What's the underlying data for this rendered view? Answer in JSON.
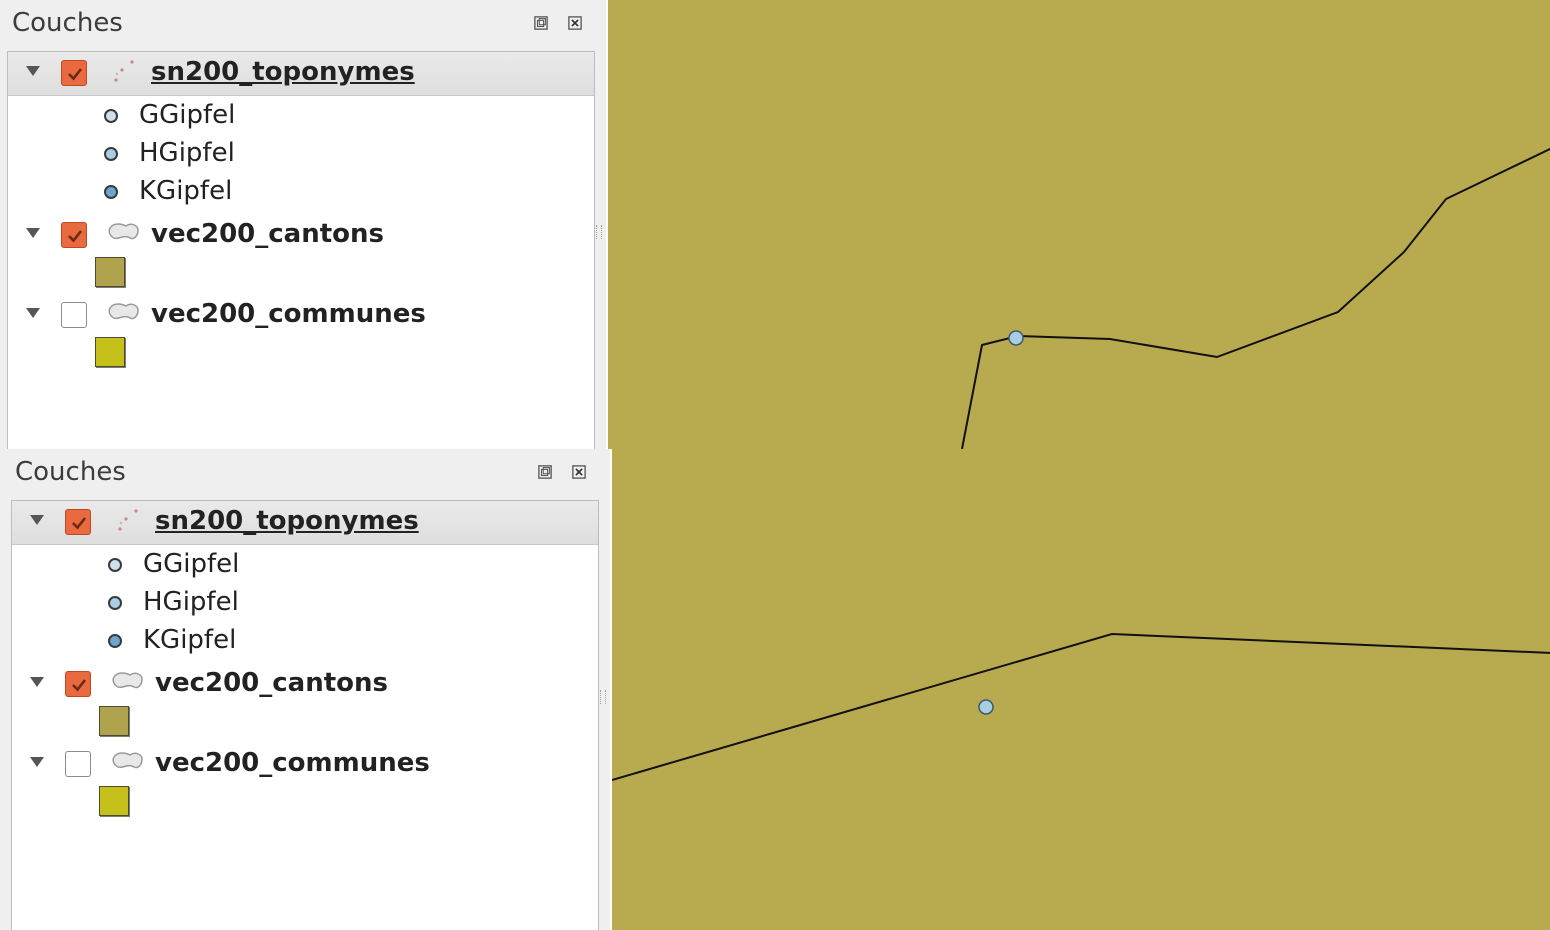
{
  "colors": {
    "map_background": "#b8aa4e",
    "checkbox_checked": "#e96a3f",
    "point_light": "#cfe0ea",
    "point_mid": "#a9cde3",
    "point_dark": "#6aa6cf",
    "cantons_fill": "#b1a24e",
    "communes_fill": "#c6c11a"
  },
  "panels": [
    {
      "dock": {
        "title": "Couches",
        "float_icon": "float-icon",
        "close_icon": "close-icon",
        "layers": [
          {
            "name": "sn200_toponymes",
            "checked": true,
            "icon": "point-layer-icon",
            "legend": [
              "GGipfel",
              "HGipfel",
              "KGipfel"
            ]
          },
          {
            "name": "vec200_cantons",
            "checked": true,
            "icon": "polygon-layer-icon"
          },
          {
            "name": "vec200_communes",
            "checked": false,
            "icon": "polygon-layer-icon"
          }
        ]
      }
    },
    {
      "dock": {
        "title": "Couches",
        "float_icon": "float-icon",
        "close_icon": "close-icon",
        "layers": [
          {
            "name": "sn200_toponymes",
            "checked": true,
            "icon": "point-layer-icon",
            "legend": [
              "GGipfel",
              "HGipfel",
              "KGipfel"
            ]
          },
          {
            "name": "vec200_cantons",
            "checked": true,
            "icon": "polygon-layer-icon"
          },
          {
            "name": "vec200_communes",
            "checked": false,
            "icon": "polygon-layer-icon"
          }
        ]
      }
    }
  ]
}
